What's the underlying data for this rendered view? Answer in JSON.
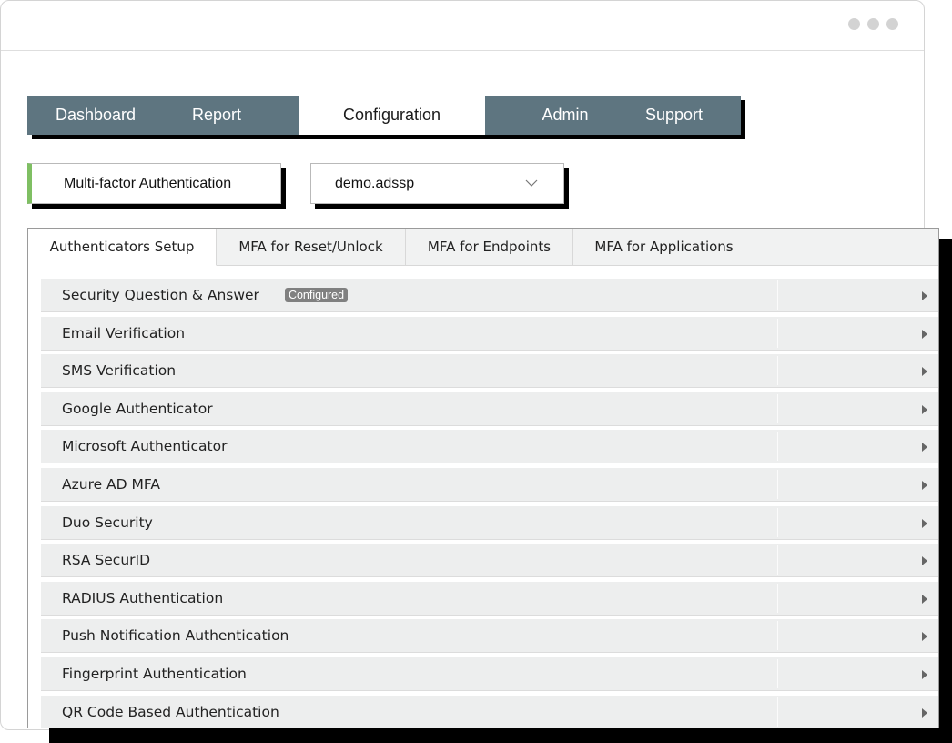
{
  "nav": {
    "items": [
      {
        "label": "Dashboard"
      },
      {
        "label": "Report"
      },
      {
        "label": "Configuration"
      },
      {
        "label": "Admin"
      },
      {
        "label": "Support"
      }
    ]
  },
  "module_select": {
    "value": "Multi-factor Authentication"
  },
  "domain_select": {
    "value": "demo.adssp"
  },
  "tabs": [
    {
      "label": "Authenticators Setup"
    },
    {
      "label": "MFA for Reset/Unlock"
    },
    {
      "label": "MFA for Endpoints"
    },
    {
      "label": "MFA for Applications"
    }
  ],
  "authenticators": [
    {
      "label": "Security Question & Answer",
      "badge": "Configured"
    },
    {
      "label": "Email Verification"
    },
    {
      "label": "SMS Verification"
    },
    {
      "label": "Google Authenticator"
    },
    {
      "label": "Microsoft Authenticator"
    },
    {
      "label": "Azure AD MFA"
    },
    {
      "label": "Duo Security"
    },
    {
      "label": "RSA SecurID"
    },
    {
      "label": "RADIUS Authentication"
    },
    {
      "label": "Push Notification Authentication"
    },
    {
      "label": "Fingerprint Authentication"
    },
    {
      "label": "QR Code Based Authentication"
    }
  ],
  "colors": {
    "nav_bg": "#5e7580",
    "accent_green": "#7fbf63",
    "row_bg": "#edeeee",
    "badge_bg": "#808080"
  }
}
